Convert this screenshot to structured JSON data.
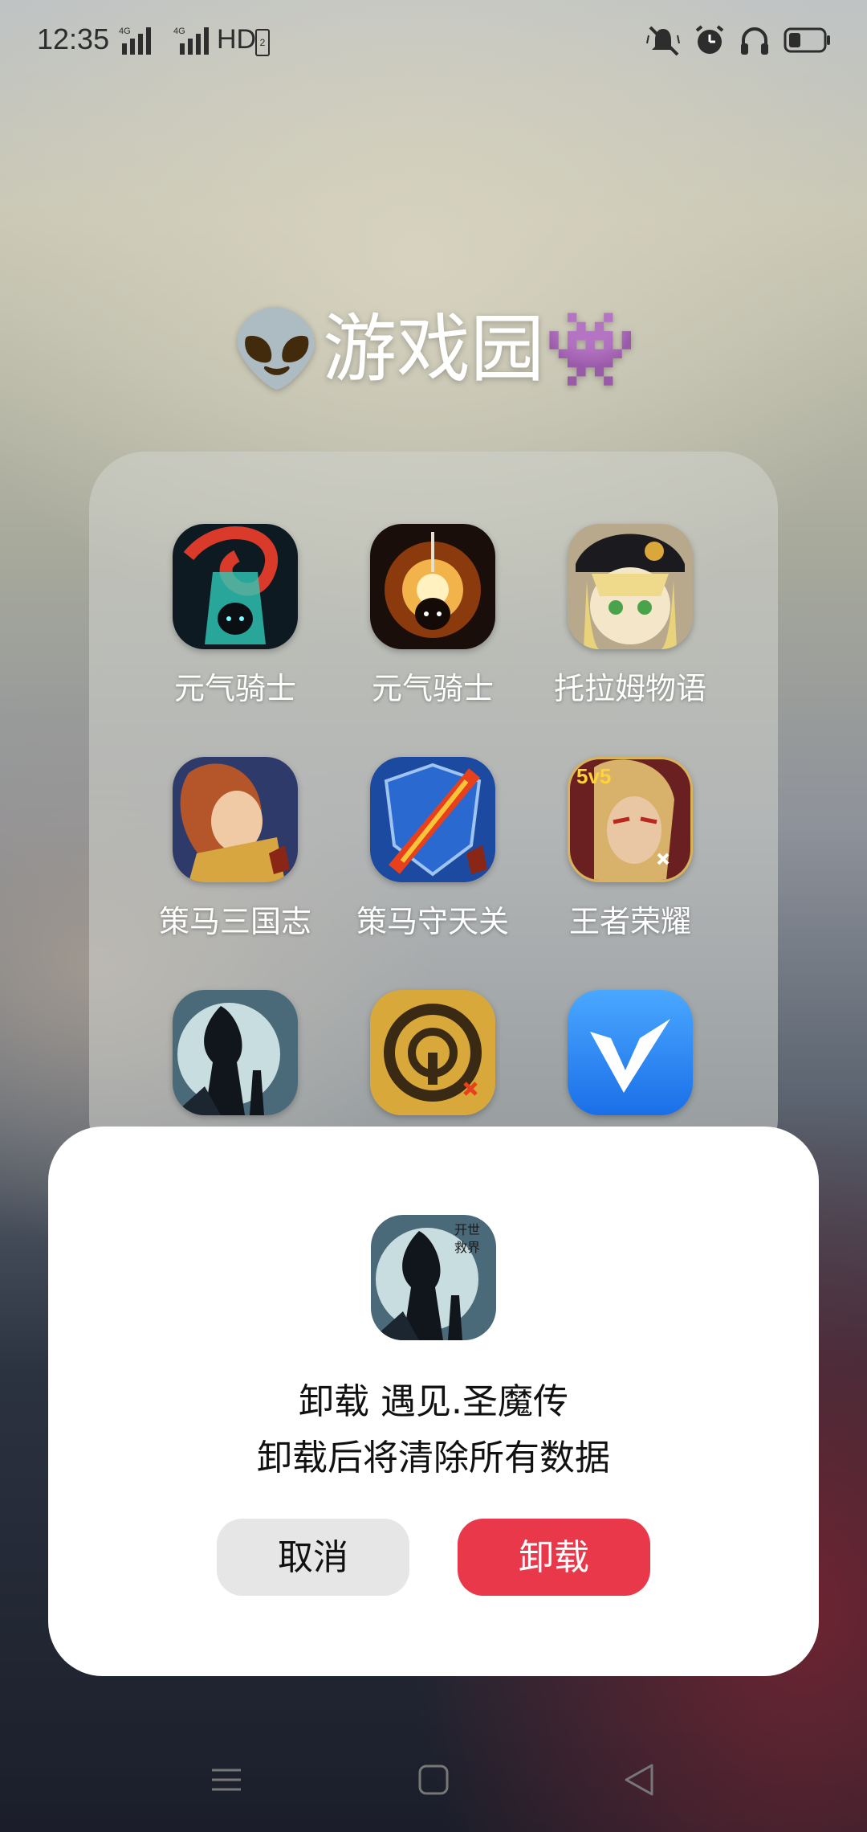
{
  "status_bar": {
    "time": "12:35",
    "signal1_label": "4G",
    "signal2_label": "4G",
    "hd_label": "HD",
    "hd_sub": "2",
    "icons": [
      "mute-icon",
      "alarm-icon",
      "headphones-icon",
      "battery-icon"
    ]
  },
  "folder": {
    "title": "👽游戏园👾",
    "apps": [
      {
        "label": "元气骑士",
        "icon": "soul-knight-icon"
      },
      {
        "label": "元气骑士",
        "icon": "soul-knight-alt-icon"
      },
      {
        "label": "托拉姆物语",
        "icon": "toram-online-icon"
      },
      {
        "label": "策马三国志",
        "icon": "cema-sanguo-icon"
      },
      {
        "label": "策马守天关",
        "icon": "cema-shoutianguan-icon"
      },
      {
        "label": "王者荣耀",
        "icon": "honor-of-kings-icon"
      },
      {
        "label": "",
        "icon": "yujian-shengmozhuan-icon"
      },
      {
        "label": "",
        "icon": "gold-target-app-icon"
      },
      {
        "label": "",
        "icon": "blue-v-app-icon"
      }
    ]
  },
  "dialog": {
    "icon": "yujian-shengmozhuan-icon",
    "icon_text_1": "开世",
    "icon_text_2": "救界",
    "title": "卸载 遇见.圣魔传",
    "message": "卸载后将清除所有数据",
    "cancel_label": "取消",
    "uninstall_label": "卸载"
  },
  "navbar": {
    "icons": [
      "menu-icon",
      "home-icon",
      "back-icon"
    ]
  },
  "colors": {
    "uninstall_button": "#e8384a",
    "cancel_button": "#e6e6e6"
  }
}
